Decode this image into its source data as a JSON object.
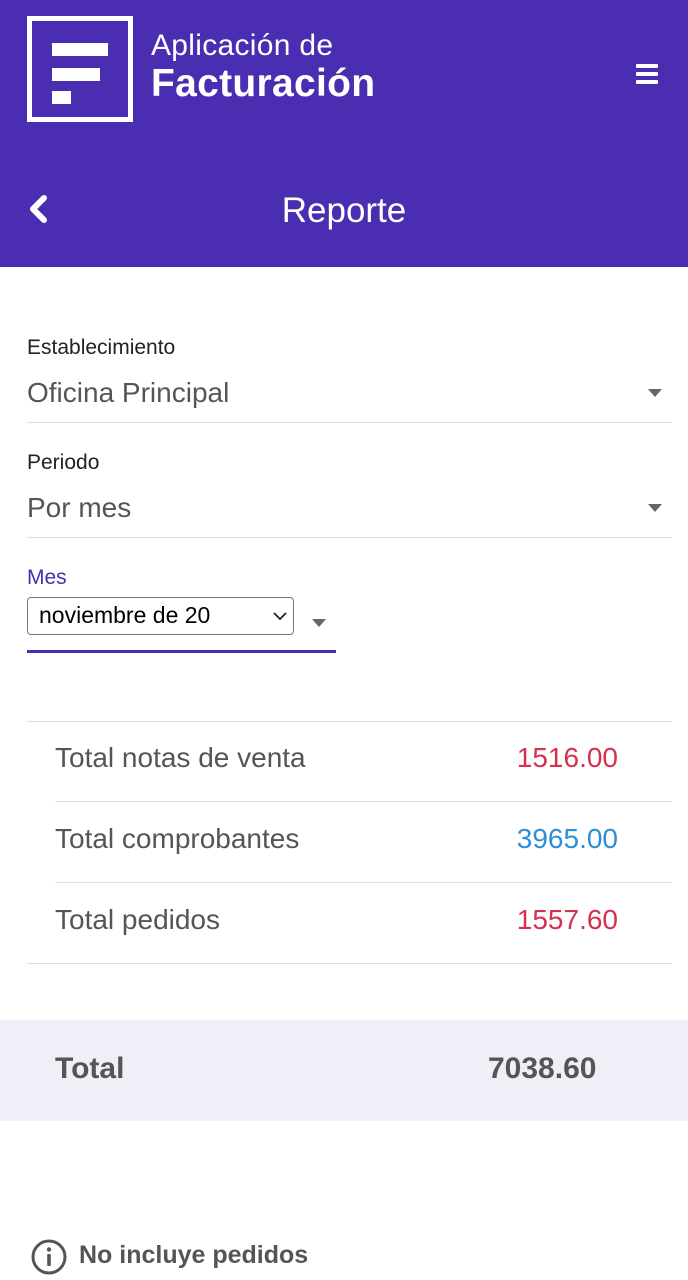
{
  "app": {
    "title_line1": "Aplicación de",
    "title_line2": "Facturación",
    "brand_color": "#4a2db0"
  },
  "header": {
    "page_title": "Reporte",
    "back_icon": "chevron-left-icon",
    "menu_icon": "hamburger-menu-icon"
  },
  "filters": {
    "establecimiento": {
      "label": "Establecimiento",
      "value": "Oficina Principal"
    },
    "periodo": {
      "label": "Periodo",
      "value": "Por mes"
    },
    "mes": {
      "label": "Mes",
      "value": "noviembre de 20"
    }
  },
  "summary": {
    "rows": [
      {
        "label": "Total notas de venta",
        "value": "1516.00",
        "color": "#d6304f"
      },
      {
        "label": "Total comprobantes",
        "value": "3965.00",
        "color": "#2d8fd6"
      },
      {
        "label": "Total pedidos",
        "value": "1557.60",
        "color": "#d6304f"
      }
    ],
    "total_label": "Total",
    "total_value": "7038.60"
  },
  "note": {
    "icon": "info-icon",
    "text": "No incluye pedidos"
  }
}
